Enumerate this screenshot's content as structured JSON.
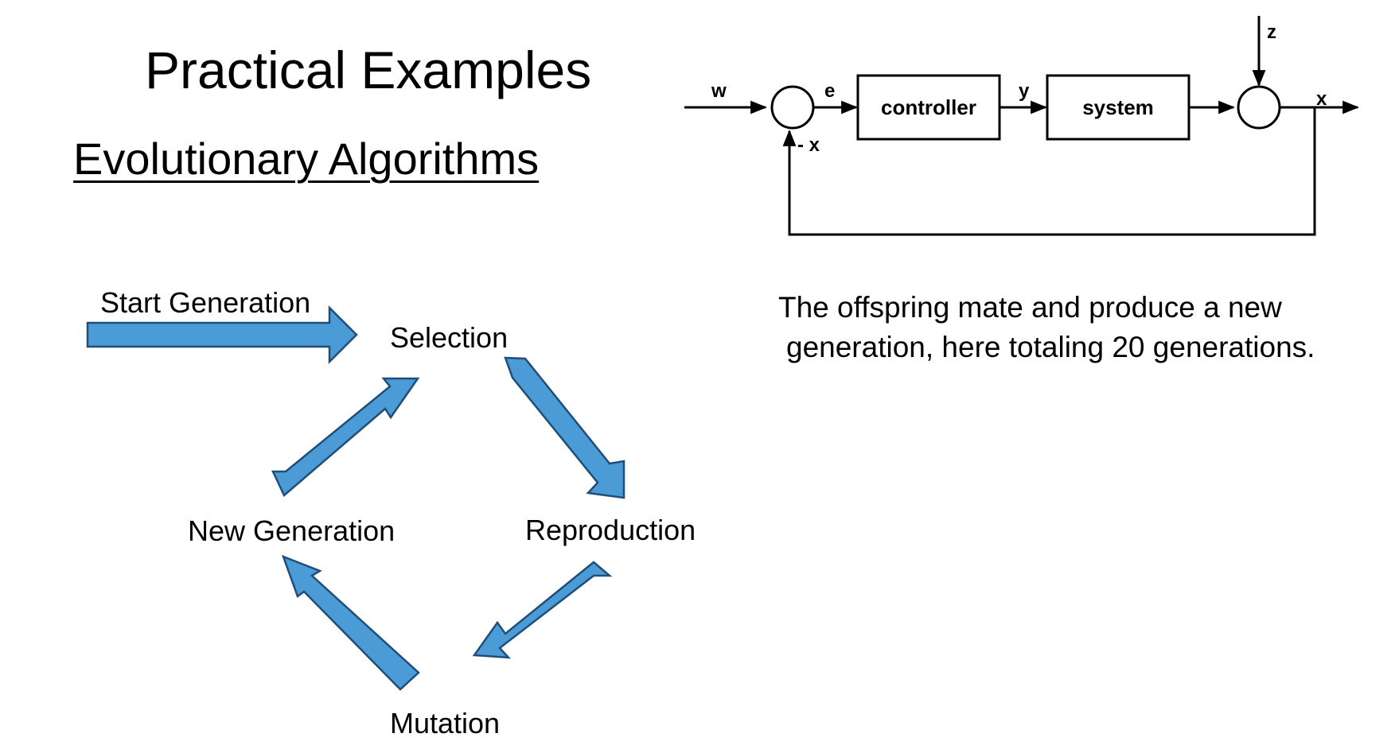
{
  "header": {
    "title": "Practical Examples",
    "subtitle": "Evolutionary Algorithms"
  },
  "cycle": {
    "start": "Start Generation",
    "selection": "Selection",
    "reproduction": "Reproduction",
    "mutation": "Mutation",
    "new_generation": "New Generation",
    "arrow_color": "#4a9bd6",
    "arrow_outline_color": "#1f4e79"
  },
  "control_loop": {
    "controller": "controller",
    "system": "system",
    "signals": {
      "w": "w",
      "e": "e",
      "y": "y",
      "z": "z",
      "x_out": "x",
      "feedback": "- x"
    }
  },
  "description": {
    "line1": "The offspring mate and produce a new",
    "line2": "generation, here totaling 20 generations."
  }
}
